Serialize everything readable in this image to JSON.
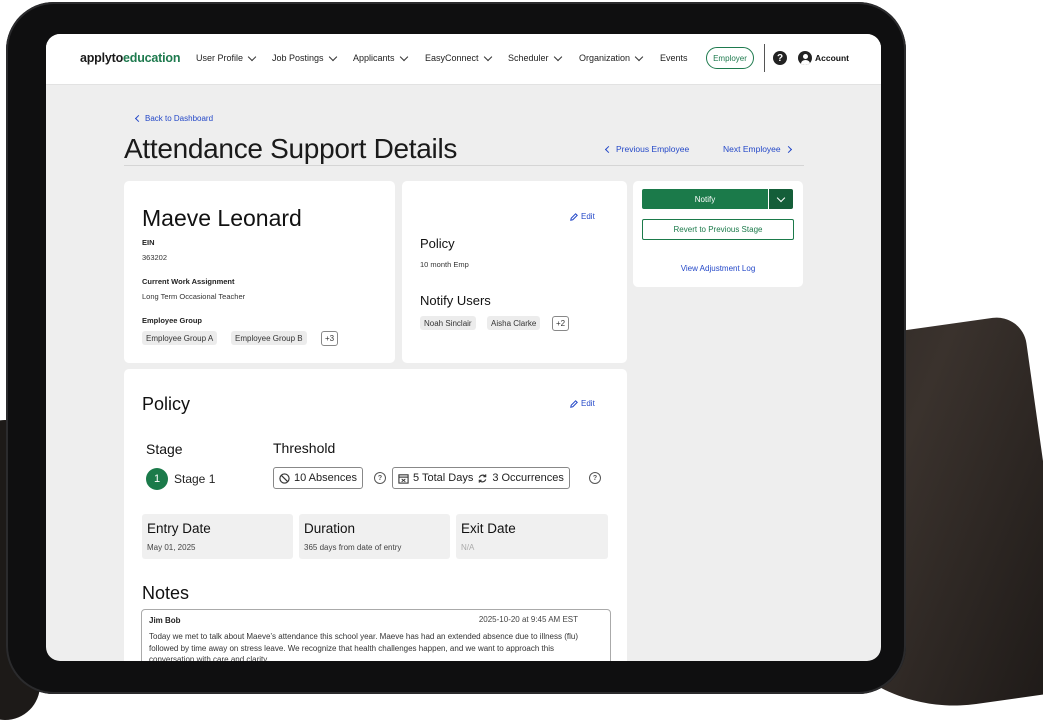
{
  "nav": {
    "logo_a": "applyto",
    "logo_b": "education",
    "items": [
      "User Profile",
      "Job Postings",
      "Applicants",
      "EasyConnect",
      "Scheduler",
      "Organization",
      "Events"
    ],
    "employer_label": "Employer",
    "help_glyph": "?",
    "account_label": "Account"
  },
  "header": {
    "back_label": "Back to Dashboard",
    "title": "Attendance Support Details",
    "prev_label": "Previous Employee",
    "next_label": "Next Employee"
  },
  "employee": {
    "name": "Maeve Leonard",
    "ein_label": "EIN",
    "ein": "363202",
    "assignment_label": "Current Work Assignment",
    "assignment": "Long Term Occasional Teacher",
    "group_label": "Employee Group",
    "groups": [
      "Employee Group A",
      "Employee Group B"
    ],
    "groups_more": "+3"
  },
  "policy_card": {
    "edit_label": "Edit",
    "policy_label": "Policy",
    "policy_value": "10 month Emp",
    "notify_label": "Notify Users",
    "users": [
      "Noah Sinclair",
      "Aisha Clarke"
    ],
    "users_more": "+2"
  },
  "actions": {
    "notify_label": "Notify",
    "revert_label": "Revert to Previous Stage",
    "adjustment_log_label": "View Adjustment Log"
  },
  "policy": {
    "title": "Policy",
    "edit_label": "Edit",
    "stage_label": "Stage",
    "stage_number": "1",
    "stage_name": "Stage 1",
    "threshold_label": "Threshold",
    "absences": "10 Absences",
    "total_days": "5 Total Days",
    "occurrences": "3 Occurrences",
    "help_glyph": "?",
    "entry_date_label": "Entry Date",
    "entry_date": "May 01, 2025",
    "duration_label": "Duration",
    "duration": "365 days from date of entry",
    "exit_date_label": "Exit Date",
    "exit_date": "N/A"
  },
  "notes": {
    "title": "Notes",
    "author": "Jim Bob",
    "timestamp": "2025-10-20 at 9:45 AM EST",
    "body": "Today we met to talk about Maeve’s attendance this school year. Maeve has had an extended absence due to illness (flu) followed by time away on stress leave. We recognize that health challenges happen, and we want to approach this conversation with care and clarity."
  },
  "colors": {
    "brand_green": "#1b7a4a",
    "link_blue": "#2448c8",
    "page_bg": "#eeeeee"
  }
}
